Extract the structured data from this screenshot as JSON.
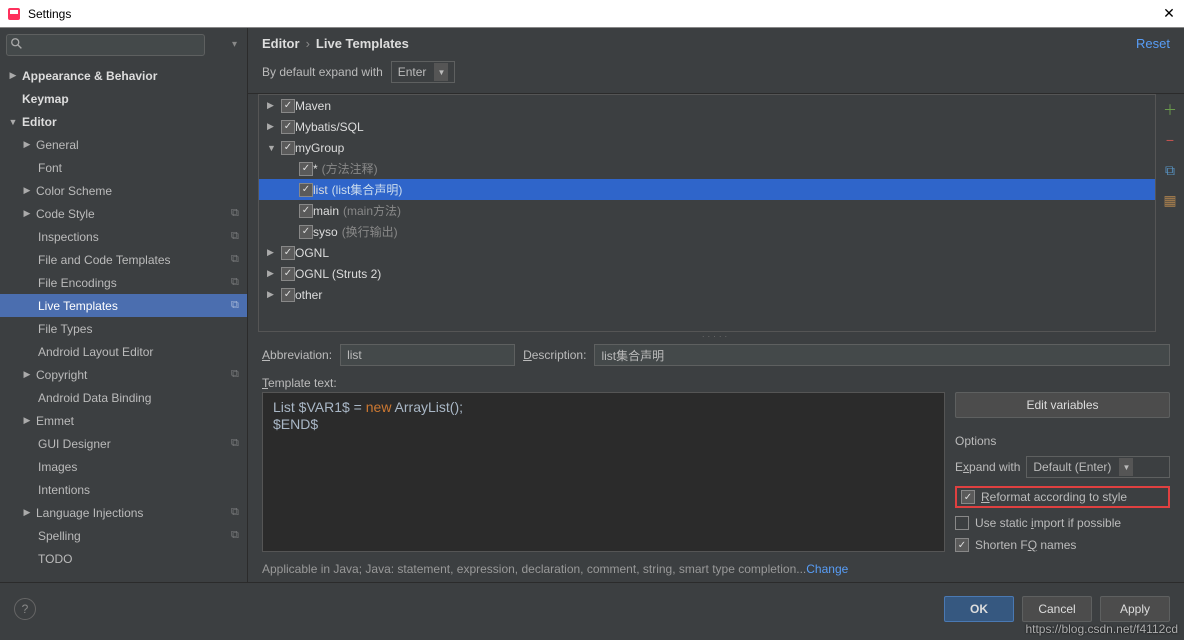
{
  "titlebar": {
    "title": "Settings"
  },
  "search": {
    "placeholder": ""
  },
  "nav": {
    "appearance": "Appearance & Behavior",
    "keymap": "Keymap",
    "editor": "Editor",
    "general": "General",
    "font": "Font",
    "color_scheme": "Color Scheme",
    "code_style": "Code Style",
    "inspections": "Inspections",
    "file_code_templates": "File and Code Templates",
    "file_encodings": "File Encodings",
    "live_templates": "Live Templates",
    "file_types": "File Types",
    "android_layout": "Android Layout Editor",
    "copyright": "Copyright",
    "android_data": "Android Data Binding",
    "emmet": "Emmet",
    "gui_designer": "GUI Designer",
    "images": "Images",
    "intentions": "Intentions",
    "lang_inj": "Language Injections",
    "spelling": "Spelling",
    "todo": "TODO"
  },
  "breadcrumb": {
    "a": "Editor",
    "b": "Live Templates",
    "reset": "Reset"
  },
  "expand_default": {
    "label": "By default expand with",
    "value": "Enter"
  },
  "templates": {
    "maven": "Maven",
    "mybatis": "Mybatis/SQL",
    "mygroup": "myGroup",
    "mygroup_items": [
      {
        "name": "*",
        "desc": "(方法注释)"
      },
      {
        "name": "list",
        "desc": "(list集合声明)",
        "sel": true
      },
      {
        "name": "main",
        "desc": "(main方法)"
      },
      {
        "name": "syso",
        "desc": "(换行输出)"
      }
    ],
    "ognl": "OGNL",
    "ognl_struts": "OGNL (Struts 2)",
    "other": "other"
  },
  "form": {
    "abbrev_label": "Abbreviation:",
    "abbrev_value": "list",
    "desc_label": "Description:",
    "desc_value": "list集合声明",
    "template_text_label": "Template text:"
  },
  "code": {
    "line1_a": "List $VAR1$ = ",
    "line1_kw": "new",
    "line1_b": " ArrayList();",
    "line2": "$END$"
  },
  "right": {
    "edit_vars": "Edit variables",
    "options": "Options",
    "expand_with": "Expand with",
    "expand_value": "Default (Enter)",
    "reformat": "Reformat according to style",
    "static_import": "Use static import if possible",
    "shorten_fq": "Shorten FQ names"
  },
  "applicable": {
    "text": "Applicable in Java; Java: statement, expression, declaration, comment, string, smart type completion...",
    "change": "Change"
  },
  "footer": {
    "ok": "OK",
    "cancel": "Cancel",
    "apply": "Apply"
  },
  "watermark": "https://blog.csdn.net/f4112cd"
}
